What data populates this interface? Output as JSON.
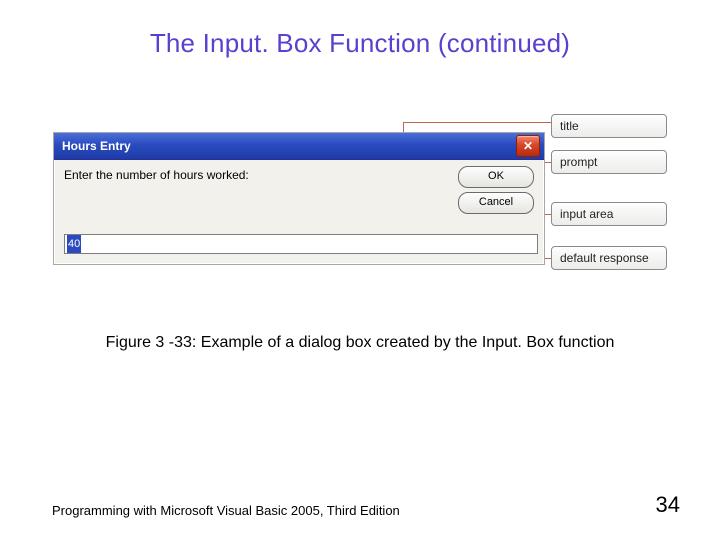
{
  "slide": {
    "title": "The Input. Box Function (continued)"
  },
  "dialog": {
    "title": "Hours Entry",
    "prompt": "Enter the number of hours worked:",
    "ok_label": "OK",
    "cancel_label": "Cancel",
    "default_value": "40"
  },
  "callouts": {
    "title": "title",
    "prompt": "prompt",
    "input_area": "input area",
    "default_response": "default response"
  },
  "caption": "Figure 3 -33: Example of a dialog box created by the Input. Box function",
  "footer": {
    "book": "Programming with Microsoft Visual Basic 2005, Third Edition",
    "page": "34"
  }
}
